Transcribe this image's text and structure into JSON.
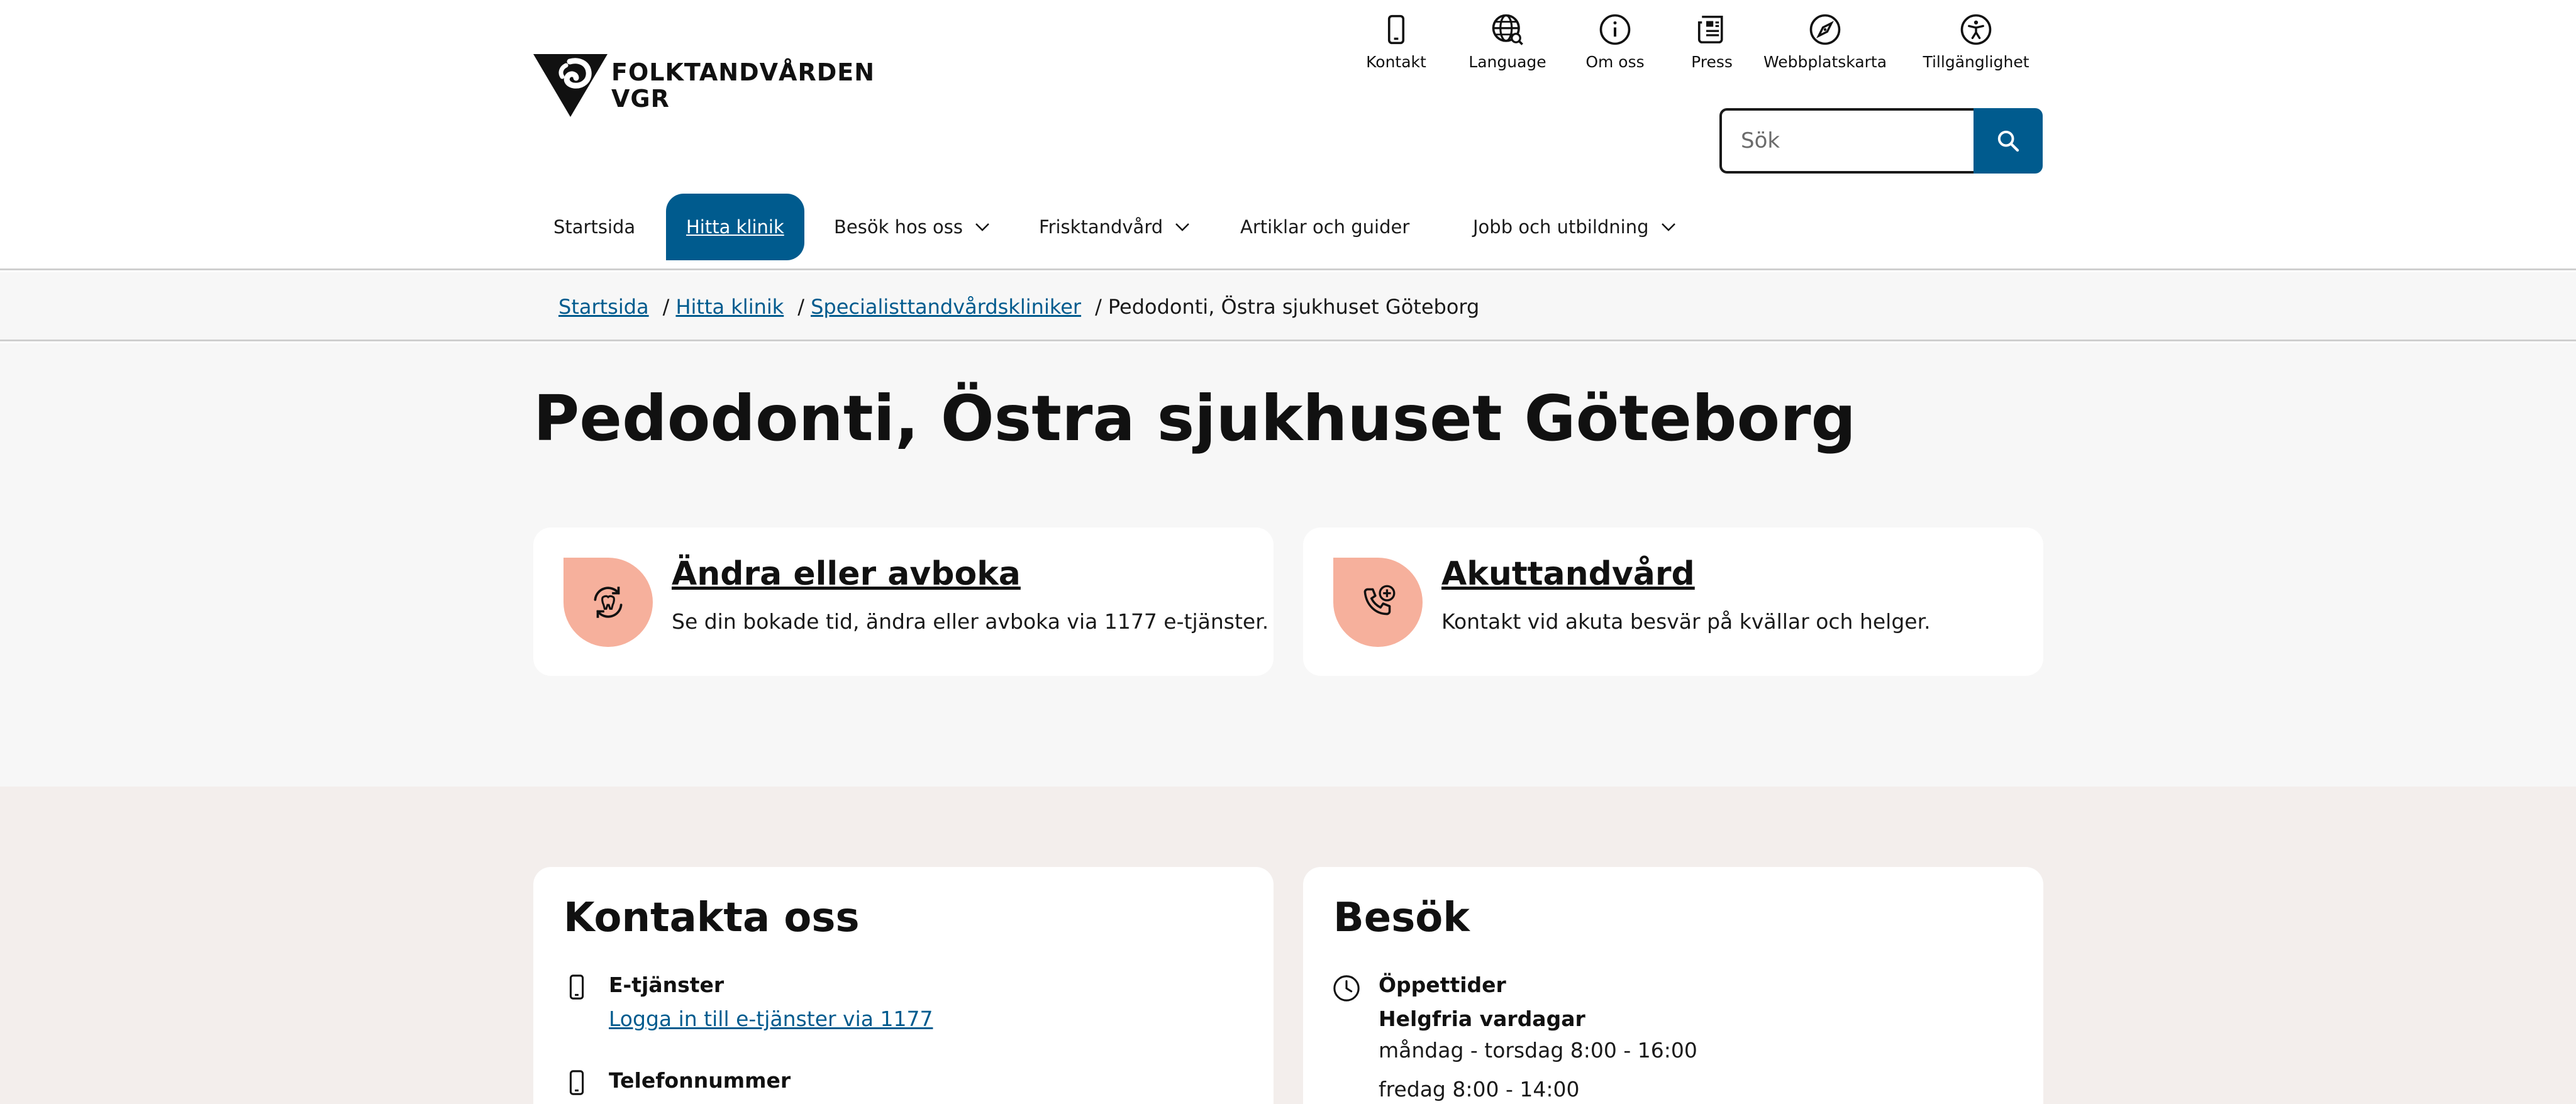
{
  "logo": {
    "line1": "FOLKTANDVÅRDEN",
    "line2": "VGR"
  },
  "util_nav": [
    {
      "label": "Kontakt",
      "icon": "phone-icon"
    },
    {
      "label": "Language",
      "icon": "globe-icon"
    },
    {
      "label": "Om oss",
      "icon": "info-icon"
    },
    {
      "label": "Press",
      "icon": "newspaper-icon"
    },
    {
      "label": "Webbplatskarta",
      "icon": "compass-icon"
    },
    {
      "label": "Tillgänglighet",
      "icon": "accessibility-icon"
    }
  ],
  "search": {
    "placeholder": "Sök"
  },
  "main_nav": [
    {
      "label": "Startsida"
    },
    {
      "label": "Hitta klinik",
      "active": true
    },
    {
      "label": "Besök hos oss",
      "dropdown": true
    },
    {
      "label": "Frisktandvård",
      "dropdown": true
    },
    {
      "label": "Artiklar och guider"
    },
    {
      "label": "Jobb och utbildning",
      "dropdown": true
    }
  ],
  "breadcrumb": {
    "items": [
      "Startsida",
      "Hitta klinik",
      "Specialisttandvårdskliniker"
    ],
    "separator": "/",
    "current": "Pedodonti, Östra sjukhuset Göteborg"
  },
  "page_title": "Pedodonti, Östra sjukhuset Göteborg",
  "quick_cards": [
    {
      "title": "Ändra eller avboka",
      "desc": "Se din bokade tid, ändra eller avboka via 1177 e-tjänster.",
      "icon": "rebook-tooth-icon"
    },
    {
      "title": "Akuttandvård",
      "desc": "Kontakt vid akuta besvär på kvällar och helger.",
      "icon": "emergency-phone-icon"
    }
  ],
  "contact": {
    "title": "Kontakta oss",
    "etjanster_label": "E-tjänster",
    "etjanster_link": "Logga in till e-tjänster via 1177",
    "phone_label": "Telefonnummer"
  },
  "visit": {
    "title": "Besök",
    "hours_label": "Öppettider",
    "days_label": "Helgfria vardagar",
    "line1": "måndag - torsdag 8:00 - 16:00",
    "line2": "fredag 8:00 - 14:00"
  },
  "colors": {
    "primary": "#005b8e",
    "accent": "#f6b09c",
    "hero_bg": "#f7f7f7",
    "lower_bg": "#f3eeec"
  }
}
